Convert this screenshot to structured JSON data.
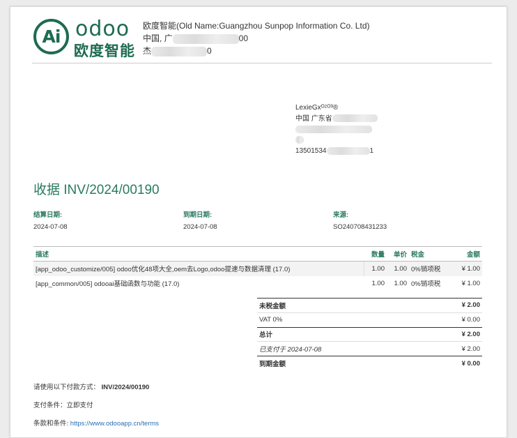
{
  "logo": {
    "mark": "Ai",
    "word": "odoo",
    "cn": "欧度智能"
  },
  "company": {
    "name": "欧度智能(Old Name:Guangzhou Sunpop Information Co. Ltd)",
    "line2_start": "中国, 广",
    "line2_end": "00",
    "line3_start": "杰",
    "line3_end": "0"
  },
  "customer": {
    "name": "LexieGxᴼᶻᴼ³®",
    "line2_start": "中国 广东省",
    "phone_start": "13501534",
    "phone_end": "1"
  },
  "invoice": {
    "title": "收据 INV/2024/00190",
    "fields": [
      {
        "label": "结算日期:",
        "value": "2024-07-08"
      },
      {
        "label": "到期日期:",
        "value": "2024-07-08"
      },
      {
        "label": "来源:",
        "value": "SO240708431233"
      }
    ]
  },
  "table": {
    "headers": {
      "desc": "描述",
      "qty": "数量",
      "price": "单价",
      "tax": "税金",
      "amount": "金额"
    },
    "rows": [
      {
        "desc": "[app_odoo_customize/005] odoo优化48项大全,oem去Logo,odoo提速与数据清理 (17.0)",
        "qty": "1.00",
        "price": "1.00",
        "tax": "0%销项税",
        "amount": "¥ 1.00"
      },
      {
        "desc": "[app_common/005] odooai基础函数与功能 (17.0)",
        "qty": "1.00",
        "price": "1.00",
        "tax": "0%销项税",
        "amount": "¥ 1.00"
      }
    ]
  },
  "totals": [
    {
      "label": "未税金额",
      "value": "¥ 2.00"
    },
    {
      "label": "VAT 0%",
      "value": "¥ 0.00"
    },
    {
      "label": "总计",
      "value": "¥ 2.00"
    },
    {
      "label": "已支付于 2024-07-08",
      "value": "¥ 2.00"
    },
    {
      "label": "到期金额",
      "value": "¥ 0.00"
    }
  ],
  "notes": {
    "payment_ref_label": "请使用以下付款方式：",
    "payment_ref_value": "INV/2024/00190",
    "payment_terms": "支付条件：立即支付",
    "terms_label": "条款和条件: ",
    "terms_link": "https://www.odooapp.cn/terms"
  },
  "colors": {
    "brand_green": "#1e6b52",
    "accent_teal": "#2a7a62",
    "link_blue": "#2a6fb0"
  }
}
